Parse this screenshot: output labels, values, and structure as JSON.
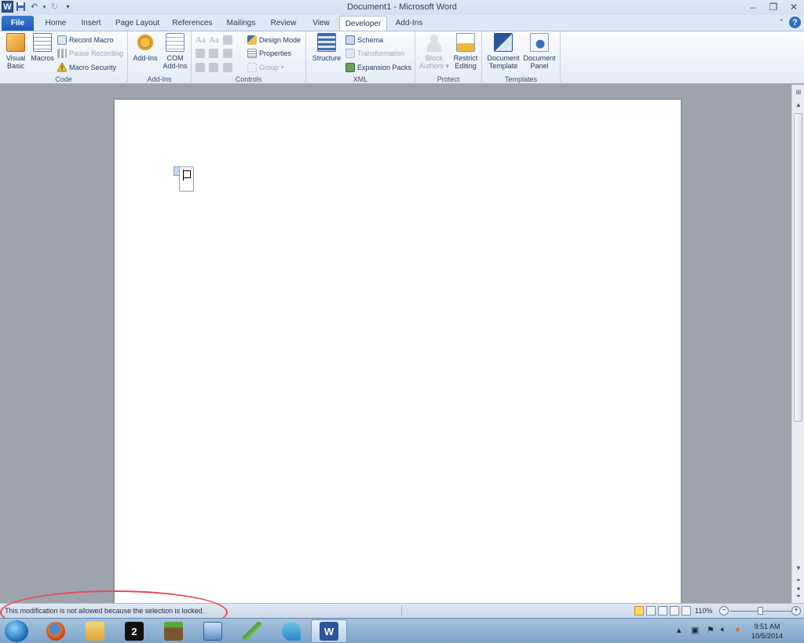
{
  "window": {
    "title": "Document1  -  Microsoft Word"
  },
  "quick_access": {
    "logo_letter": "W",
    "save_icon": "save-icon",
    "undo_icon": "undo-icon",
    "redo_icon": "redo-icon",
    "customize_icon": "customize-qat-icon"
  },
  "tabs": [
    {
      "label": "File"
    },
    {
      "label": "Home"
    },
    {
      "label": "Insert"
    },
    {
      "label": "Page Layout"
    },
    {
      "label": "References"
    },
    {
      "label": "Mailings"
    },
    {
      "label": "Review"
    },
    {
      "label": "View"
    },
    {
      "label": "Developer"
    },
    {
      "label": "Add-Ins"
    }
  ],
  "ribbon": {
    "code": {
      "label": "Code",
      "visual_basic": [
        "Visual",
        "Basic"
      ],
      "macros": "Macros",
      "record_macro": "Record Macro",
      "pause_recording": "Pause Recording",
      "macro_security": "Macro Security"
    },
    "addins": {
      "label": "Add-Ins",
      "addins_btn": "Add-Ins",
      "com_addins": [
        "COM",
        "Add-Ins"
      ]
    },
    "controls": {
      "label": "Controls",
      "design_mode": "Design Mode",
      "properties": "Properties",
      "group": "Group",
      "aa1": "Aa",
      "aa2": "Aa"
    },
    "xml": {
      "label": "XML",
      "structure": "Structure",
      "schema": "Schema",
      "transformation": "Transformation",
      "expansion_packs": "Expansion Packs"
    },
    "protect": {
      "label": "Protect",
      "block_authors": [
        "Block",
        "Authors"
      ],
      "restrict_editing": [
        "Restrict",
        "Editing"
      ]
    },
    "templates": {
      "label": "Templates",
      "document_template": [
        "Document",
        "Template"
      ],
      "document_panel": [
        "Document",
        "Panel"
      ]
    }
  },
  "status_bar": {
    "message": "This modification is not allowed because the selection is locked.",
    "zoom": "110%",
    "zoom_fraction": 0.5
  },
  "taskbar": {
    "clock_time": "9:51 AM",
    "clock_date": "10/5/2014",
    "word_letter": "W",
    "app2_label": "2"
  },
  "colors": {
    "accent": "#2a5699",
    "annotation": "#e8485f"
  }
}
